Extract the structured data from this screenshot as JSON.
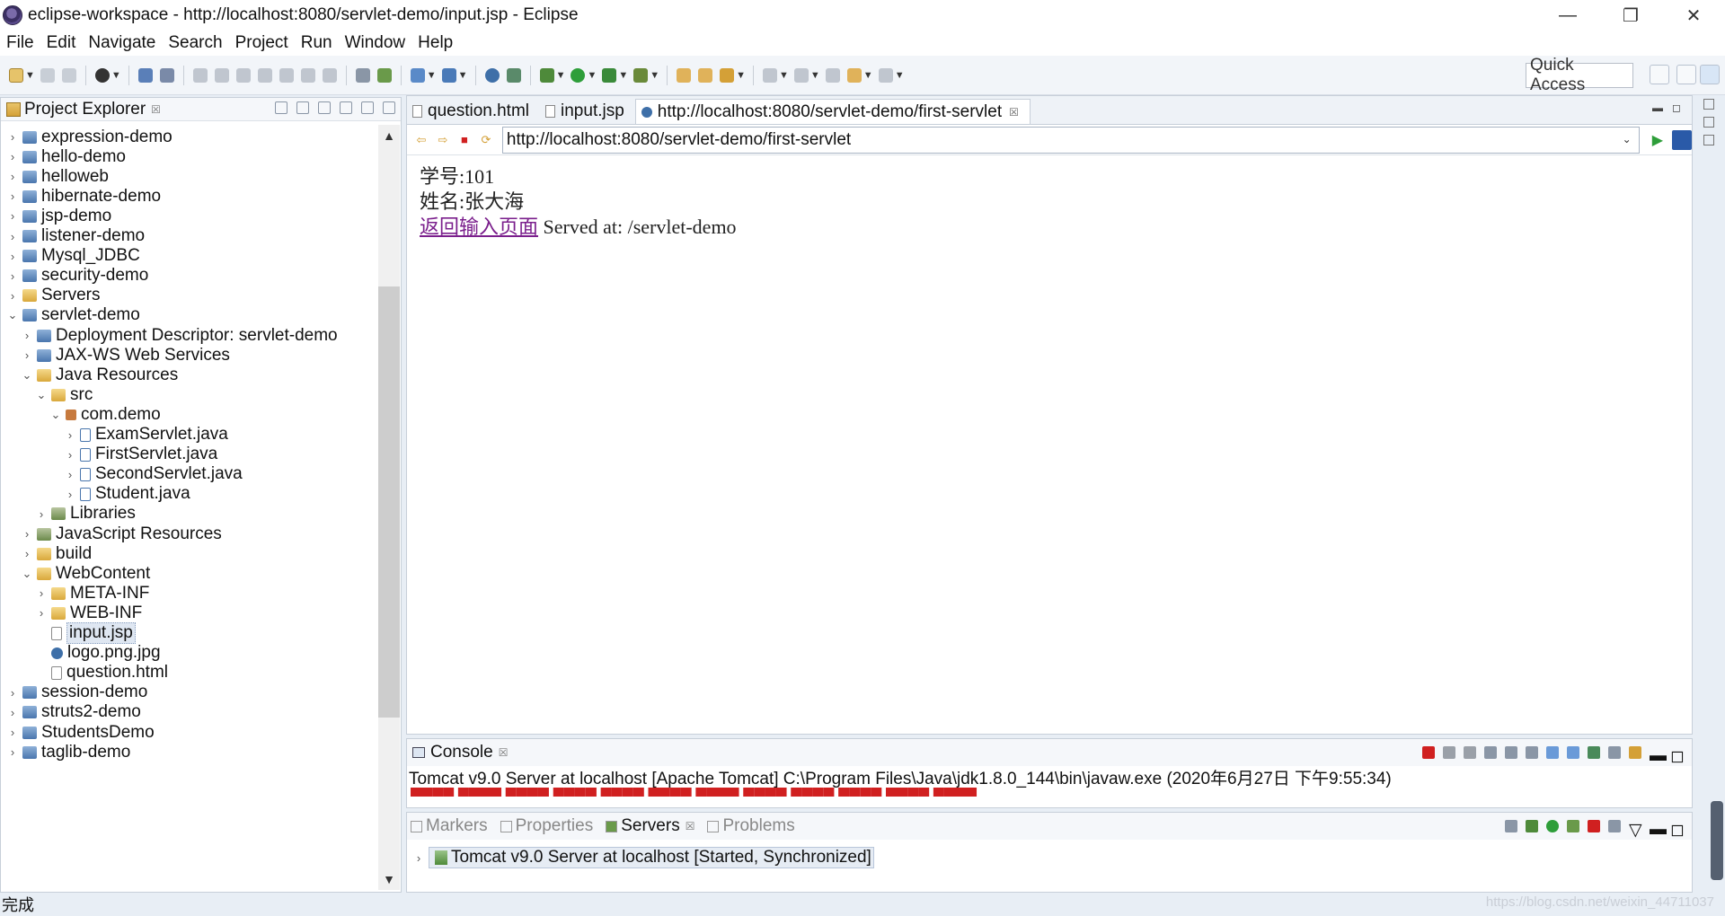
{
  "window": {
    "title": "eclipse-workspace - http://localhost:8080/servlet-demo/input.jsp - Eclipse",
    "minimize": "—",
    "restore": "❐",
    "close": "✕"
  },
  "menu": [
    {
      "label": "File"
    },
    {
      "label": "Edit"
    },
    {
      "label": "Navigate"
    },
    {
      "label": "Search"
    },
    {
      "label": "Project"
    },
    {
      "label": "Run"
    },
    {
      "label": "Window"
    },
    {
      "label": "Help"
    }
  ],
  "toolbar": {
    "quick_access": "Quick Access"
  },
  "project_explorer": {
    "title": "Project Explorer",
    "close": "☒",
    "scroll_up": "▲",
    "scroll_down": "▼",
    "items": [
      {
        "label": "expression-demo",
        "twisty": "›",
        "icon": "project-icon"
      },
      {
        "label": "hello-demo",
        "twisty": "›",
        "icon": "project-icon"
      },
      {
        "label": "helloweb",
        "twisty": "›",
        "icon": "project-icon"
      },
      {
        "label": "hibernate-demo",
        "twisty": "›",
        "icon": "project-icon"
      },
      {
        "label": "jsp-demo",
        "twisty": "›",
        "icon": "project-icon"
      },
      {
        "label": "listener-demo",
        "twisty": "›",
        "icon": "project-icon"
      },
      {
        "label": "Mysql_JDBC",
        "twisty": "›",
        "icon": "project-icon"
      },
      {
        "label": "security-demo",
        "twisty": "›",
        "icon": "project-icon"
      },
      {
        "label": "Servers",
        "twisty": "›",
        "icon": "folder-icon"
      },
      {
        "label": "servlet-demo",
        "twisty": "⌄",
        "icon": "project-icon"
      },
      {
        "label": "Deployment Descriptor: servlet-demo",
        "twisty": "›",
        "icon": "descriptor-icon"
      },
      {
        "label": "JAX-WS Web Services",
        "twisty": "›",
        "icon": "webservice-icon"
      },
      {
        "label": "Java Resources",
        "twisty": "⌄",
        "icon": "folder-icon"
      },
      {
        "label": "src",
        "twisty": "⌄",
        "icon": "folder-icon"
      },
      {
        "label": "com.demo",
        "twisty": "⌄",
        "icon": "package-icon"
      },
      {
        "label": "ExamServlet.java",
        "twisty": "›",
        "icon": "java-file-icon"
      },
      {
        "label": "FirstServlet.java",
        "twisty": "›",
        "icon": "java-file-icon"
      },
      {
        "label": "SecondServlet.java",
        "twisty": "›",
        "icon": "java-file-icon"
      },
      {
        "label": "Student.java",
        "twisty": "›",
        "icon": "java-file-icon"
      },
      {
        "label": "Libraries",
        "twisty": "›",
        "icon": "library-icon"
      },
      {
        "label": "JavaScript Resources",
        "twisty": "›",
        "icon": "library-icon"
      },
      {
        "label": "build",
        "twisty": "›",
        "icon": "folder-icon"
      },
      {
        "label": "WebContent",
        "twisty": "⌄",
        "icon": "folder-icon"
      },
      {
        "label": "META-INF",
        "twisty": "›",
        "icon": "folder-icon"
      },
      {
        "label": "WEB-INF",
        "twisty": "›",
        "icon": "folder-icon"
      },
      {
        "label": "input.jsp",
        "twisty": "",
        "icon": "file-icon"
      },
      {
        "label": "logo.png.jpg",
        "twisty": "",
        "icon": "image-icon"
      },
      {
        "label": "question.html",
        "twisty": "",
        "icon": "file-icon"
      },
      {
        "label": "session-demo",
        "twisty": "›",
        "icon": "project-icon"
      },
      {
        "label": "struts2-demo",
        "twisty": "›",
        "icon": "project-icon"
      },
      {
        "label": "StudentsDemo",
        "twisty": "›",
        "icon": "project-icon"
      },
      {
        "label": "taglib-demo",
        "twisty": "›",
        "icon": "project-icon"
      }
    ]
  },
  "editor": {
    "tabs": [
      {
        "label": "question.html"
      },
      {
        "label": "input.jsp"
      },
      {
        "label": "http://localhost:8080/servlet-demo/first-servlet",
        "close": "☒"
      }
    ],
    "url": "http://localhost:8080/servlet-demo/first-servlet",
    "url_dropdown": "⌄",
    "page": {
      "line1": "学号:101",
      "line2": "姓名:张大海",
      "link": "返回输入页面",
      "served": " Served at: /servlet-demo"
    }
  },
  "console": {
    "title": "Console",
    "close": "☒",
    "line": "Tomcat v9.0 Server at localhost [Apache Tomcat] C:\\Program Files\\Java\\jdk1.8.0_144\\bin\\javaw.exe (2020年6月27日 下午9:55:34)"
  },
  "servers_panel": {
    "tabs": [
      {
        "label": "Markers"
      },
      {
        "label": "Properties"
      },
      {
        "label": "Servers",
        "close": "☒"
      },
      {
        "label": "Problems"
      }
    ],
    "server": "Tomcat v9.0 Server at localhost  [Started, Synchronized]"
  },
  "status": {
    "text": "完成"
  },
  "watermark": "https://blog.csdn.net/weixin_44711037"
}
